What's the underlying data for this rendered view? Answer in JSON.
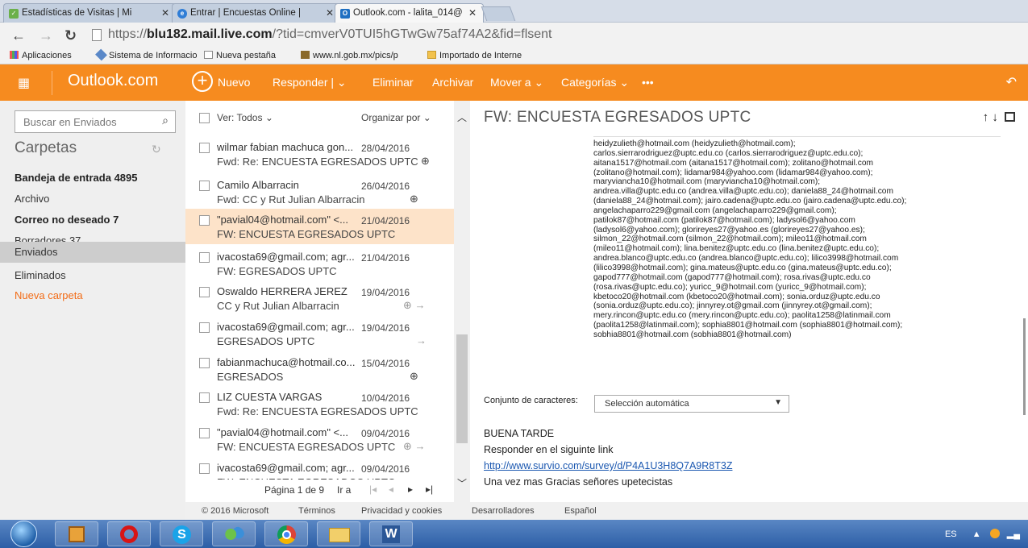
{
  "browser": {
    "tabs": [
      {
        "label": "Estadísticas de Visitas | Mi",
        "icon": "check-icon",
        "active": false
      },
      {
        "label": "Entrar | Encuestas Online |",
        "icon": "chrome-icon",
        "active": false
      },
      {
        "label": "Outlook.com - lalita_014@",
        "icon": "outlook-icon",
        "active": true
      }
    ],
    "url_prefix": "https://",
    "url_domain": "blu182.mail.live.com",
    "url_rest": "/?tid=cmverV0TUI5hGTwGw75af74A2&fid=flsent",
    "bookmarks": [
      "Aplicaciones",
      "Sistema de Informacio",
      "Nueva pestaña",
      "www.nl.gob.mx/pics/p",
      "Importado de Interne"
    ]
  },
  "header": {
    "brand": "Outlook.com",
    "commands": [
      "Nuevo",
      "Responder |",
      "Eliminar",
      "Archivar",
      "Mover a",
      "Categorías",
      "•••"
    ]
  },
  "nav": {
    "search_placeholder": "Buscar en Enviados",
    "title": "Carpetas",
    "folders": [
      {
        "label": "Bandeja de entrada",
        "count": "4895",
        "bold": true
      },
      {
        "label": "Archivo",
        "count": "",
        "bold": false
      },
      {
        "label": "Correo no deseado",
        "count": "7",
        "bold": true
      },
      {
        "label": "Borradores",
        "count": "37",
        "bold": false
      },
      {
        "label": "Enviados",
        "count": "",
        "bold": false,
        "selected": true
      },
      {
        "label": "Eliminados",
        "count": "",
        "bold": false
      },
      {
        "label": "Nueva carpeta",
        "count": "",
        "bold": false,
        "accent": true
      }
    ]
  },
  "list": {
    "filter": "Ver: Todos",
    "sort": "Organizar por",
    "messages": [
      {
        "from": "wilmar fabian machuca gon...",
        "date": "28/04/2016",
        "subject": "Fwd: Re: ENCUESTA EGRESADOS UPTC",
        "att": "⊕"
      },
      {
        "from": "Camilo Albarracin",
        "date": "26/04/2016",
        "subject": "Fwd: CC y Rut Julian Albarracin",
        "att": "⊕"
      },
      {
        "from": "\"pavial04@hotmail.com\" <...",
        "date": "21/04/2016",
        "subject": "FW: ENCUESTA EGRESADOS UPTC",
        "att": "",
        "selected": true
      },
      {
        "from": "ivacosta69@gmail.com; agr...",
        "date": "21/04/2016",
        "subject": "FW: EGRESADOS UPTC",
        "att": ""
      },
      {
        "from": "Oswaldo HERRERA JEREZ",
        "date": "19/04/2016",
        "subject": "CC y Rut Julian Albarracin",
        "att": "⊕ →"
      },
      {
        "from": "ivacosta69@gmail.com; agr...",
        "date": "19/04/2016",
        "subject": "EGRESADOS UPTC",
        "att": "→"
      },
      {
        "from": "fabianmachuca@hotmail.co...",
        "date": "15/04/2016",
        "subject": "EGRESADOS",
        "att": "⊕"
      },
      {
        "from": "LIZ CUESTA VARGAS",
        "date": "10/04/2016",
        "subject": "Fwd: Re: ENCUESTA EGRESADOS UPTC",
        "att": ""
      },
      {
        "from": "\"pavial04@hotmail.com\" <...",
        "date": "09/04/2016",
        "subject": "FW: ENCUESTA EGRESADOS UPTC",
        "att": "⊕ →"
      },
      {
        "from": "ivacosta69@gmail.com; agr...",
        "date": "09/04/2016",
        "subject": "FW: ENCUESTA EGRESADOS UPTC",
        "att": ""
      }
    ],
    "pager": "Página 1 de 9",
    "pager_go": "Ir a"
  },
  "reading": {
    "subject": "FW: ENCUESTA EGRESADOS UPTC",
    "recipients": [
      "heidyzulieth@hotmail.com (heidyzulieth@hotmail.com);",
      "carlos.sierrarodriguez@uptc.edu.co (carlos.sierrarodriguez@uptc.edu.co);",
      "aitana1517@hotmail.com (aitana1517@hotmail.com); zolitano@hotmail.com",
      "(zolitano@hotmail.com); lidamar984@yahoo.com (lidamar984@yahoo.com);",
      "maryviancha10@hotmail.com (maryviancha10@hotmail.com);",
      "andrea.villa@uptc.edu.co (andrea.villa@uptc.edu.co); daniela88_24@hotmail.com",
      "(daniela88_24@hotmail.com); jairo.cadena@uptc.edu.co (jairo.cadena@uptc.edu.co);",
      "angelachaparro229@gmail.com (angelachaparro229@gmail.com);",
      "patilok87@hotmail.com (patilok87@hotmail.com); ladysol6@yahoo.com",
      "(ladysol6@yahoo.com); glorireyes27@yahoo.es (glorireyes27@yahoo.es);",
      "silmon_22@hotmail.com (silmon_22@hotmail.com); mileo11@hotmail.com",
      "(mileo11@hotmail.com); lina.benitez@uptc.edu.co (lina.benitez@uptc.edu.co);",
      "andrea.blanco@uptc.edu.co (andrea.blanco@uptc.edu.co); lilico3998@hotmail.com",
      "(lilico3998@hotmail.com); gina.mateus@uptc.edu.co (gina.mateus@uptc.edu.co);",
      "gapod777@hotmail.com (gapod777@hotmail.com); rosa.rivas@uptc.edu.co",
      "(rosa.rivas@uptc.edu.co); yuricc_9@hotmail.com (yuricc_9@hotmail.com);",
      "kbetoco20@hotmail.com (kbetoco20@hotmail.com); sonia.orduz@uptc.edu.co",
      "(sonia.orduz@uptc.edu.co); jinnyrey.ot@gmail.com (jinnyrey.ot@gmail.com);",
      "mery.rincon@uptc.edu.co (mery.rincon@uptc.edu.co); paolita1258@latinmail.com",
      "(paolita1258@latinmail.com); sophia8801@hotmail.com (sophia8801@hotmail.com);",
      "sobhia8801@hotmail.com (sobhia8801@hotmail.com)"
    ],
    "charset_label": "Conjunto de caracteres:",
    "charset_value": "Selección automática",
    "body": [
      "BUENA TARDE",
      "Responder en el siguinte link",
      "http://www.survio.com/survey/d/P4A1U3H8Q7A9R8T3Z",
      "Una vez mas Gracias señores upetecistas"
    ]
  },
  "footer": [
    "© 2016 Microsoft",
    "Términos",
    "Privacidad y cookies",
    "Desarrolladores",
    "Español"
  ],
  "taskbar": {
    "lang": "ES"
  }
}
